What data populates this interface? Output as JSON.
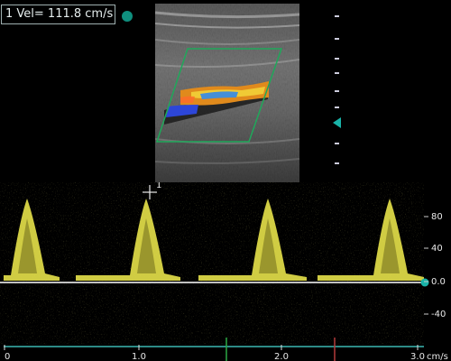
{
  "measurement": {
    "velocity_text": "1 Vel= 111.8 cm/s"
  },
  "doppler_scale": {
    "unit": "cm/s",
    "ticks": [
      "80",
      "40",
      "0.0",
      "-40"
    ]
  },
  "time_scale": {
    "ticks": [
      "0",
      "1.0",
      "2.0",
      "3.0"
    ]
  },
  "cursor_label": "1",
  "colors": {
    "spectrum": "#e7e24a",
    "baseline": "#ffffff",
    "accent": "#19b3a8",
    "color_box": "#1fa85a",
    "time_marker_green": "#2aa844",
    "time_marker_red": "#b23a3a"
  }
}
